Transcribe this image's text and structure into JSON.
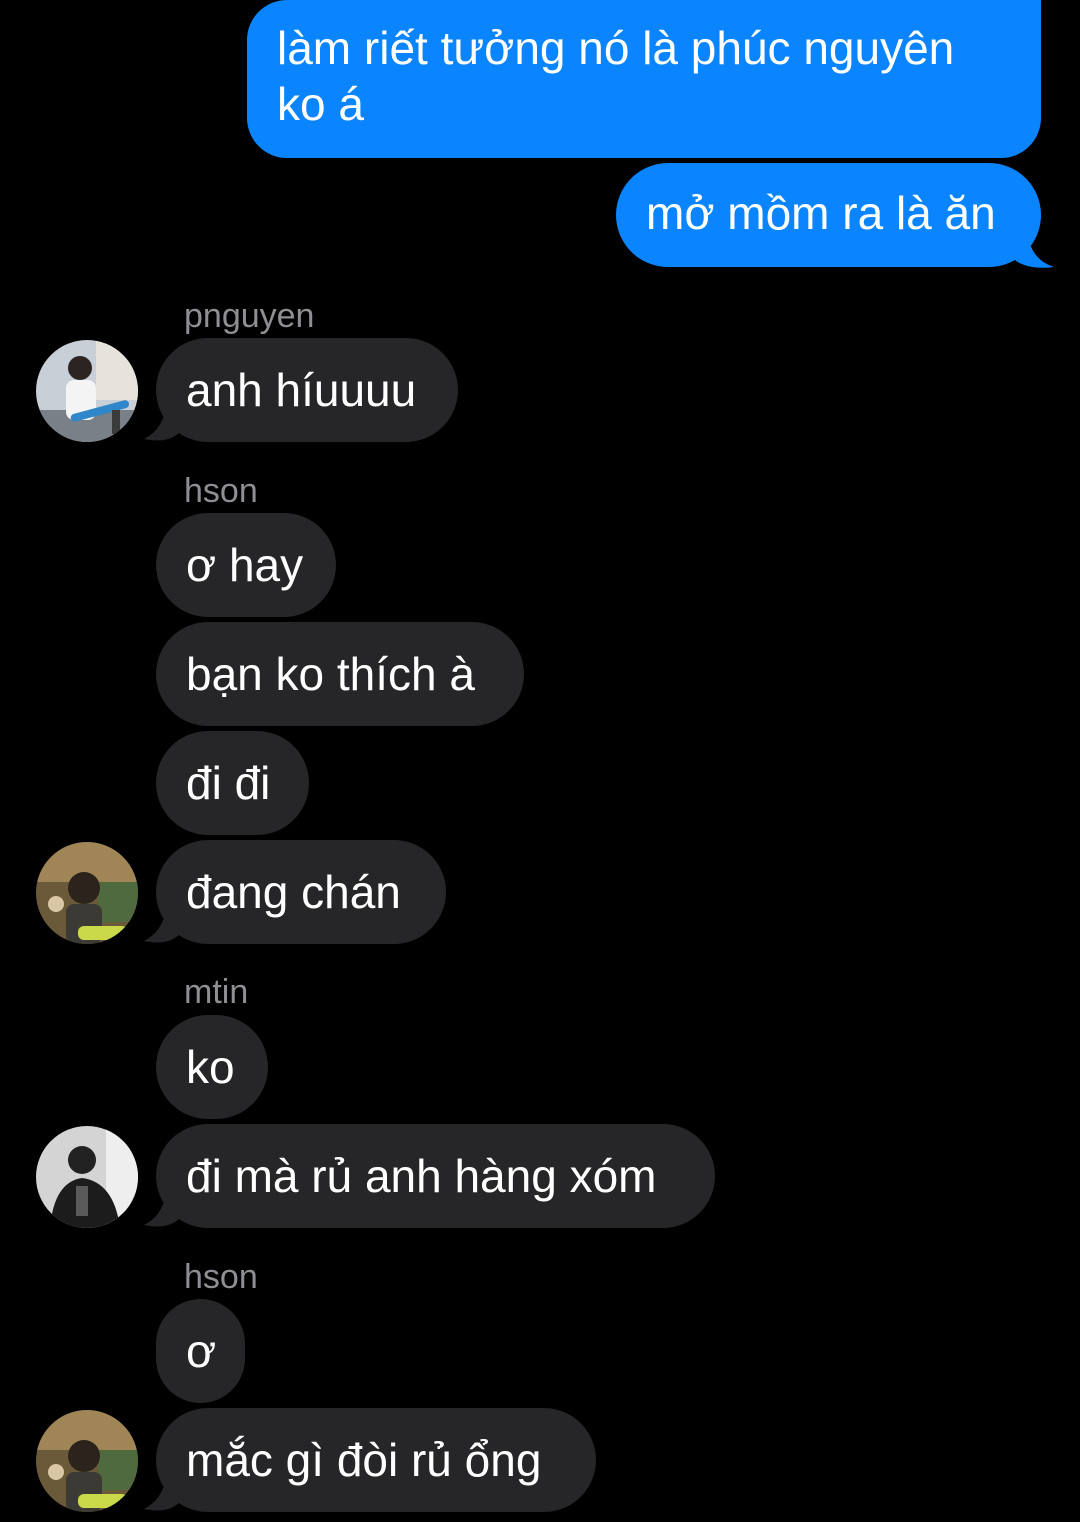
{
  "conversation": {
    "outgoing": [
      {
        "text": "làm riết tưởng nó là phúc nguyên ko á"
      },
      {
        "text": "mở mồm ra là ăn"
      }
    ],
    "groups": [
      {
        "sender": "pnguyen",
        "avatar": "guitarist-photo",
        "messages": [
          "anh híuuuu"
        ]
      },
      {
        "sender": "hson",
        "avatar": "cafe-selfie-photo",
        "messages": [
          "ơ hay",
          "bạn ko thích à",
          "đi đi",
          "đang chán"
        ]
      },
      {
        "sender": "mtin",
        "avatar": "black-white-jacket-photo",
        "messages": [
          "ko",
          "đi mà rủ anh hàng xóm"
        ]
      },
      {
        "sender": "hson",
        "avatar": "cafe-selfie-photo",
        "messages": [
          "ơ",
          "mắc gì đòi rủ ổng"
        ]
      }
    ]
  },
  "colors": {
    "background": "#000000",
    "outgoing_bubble": "#0a84ff",
    "incoming_bubble": "#262628",
    "sender_name": "#8e8e93",
    "text": "#ffffff"
  }
}
